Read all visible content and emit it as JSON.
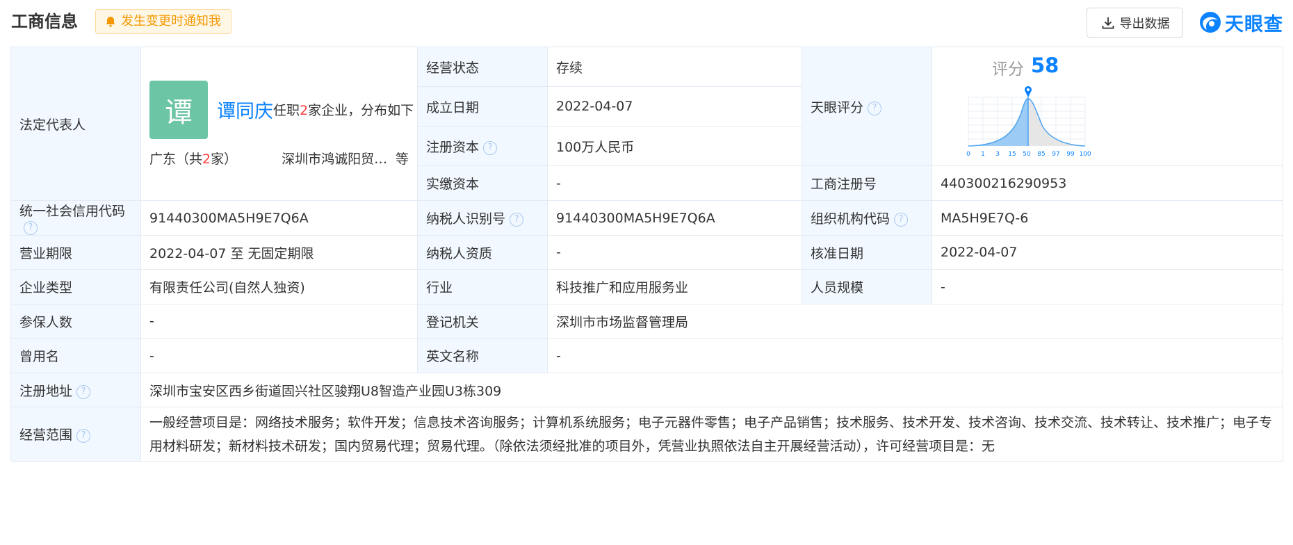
{
  "header": {
    "title": "工商信息",
    "notify_label": "发生变更时通知我",
    "export_label": "导出数据",
    "logo_text": "天眼查"
  },
  "colors": {
    "accent": "#0b83ff",
    "key_bg": "#f2f8ff",
    "border": "#e4eaf2",
    "notify_bg": "#fff7e6",
    "notify_text": "#f39800",
    "avatar_bg": "#6cc5a5",
    "highlight_red": "#ff3c3c"
  },
  "legal_rep": {
    "label": "法定代表人",
    "avatar_char": "谭",
    "name": "谭同庆",
    "desc_prefix": "任职",
    "desc_count": "2",
    "desc_suffix": "家企业，分布如下",
    "region_prefix": "广东（共",
    "region_count": "2",
    "region_suffix": "家）",
    "company": "深圳市鸿诚阳贸易有...",
    "more": "等"
  },
  "fields": {
    "status_label": "经营状态",
    "status_value": "存续",
    "founded_label": "成立日期",
    "founded_value": "2022-04-07",
    "reg_capital_label": "注册资本",
    "reg_capital_value": "100万人民币",
    "paid_capital_label": "实缴资本",
    "paid_capital_value": "-",
    "score_label": "天眼评分",
    "reg_no_label": "工商注册号",
    "reg_no_value": "440300216290953",
    "credit_code_label": "统一社会信用代码",
    "credit_code_value": "91440300MA5H9E7Q6A",
    "taxpayer_id_label": "纳税人识别号",
    "taxpayer_id_value": "91440300MA5H9E7Q6A",
    "org_code_label": "组织机构代码",
    "org_code_value": "MA5H9E7Q-6",
    "term_label": "营业期限",
    "term_value": "2022-04-07 至 无固定期限",
    "taxpayer_qual_label": "纳税人资质",
    "taxpayer_qual_value": "-",
    "approve_date_label": "核准日期",
    "approve_date_value": "2022-04-07",
    "type_label": "企业类型",
    "type_value": "有限责任公司(自然人独资)",
    "industry_label": "行业",
    "industry_value": "科技推广和应用服务业",
    "staff_size_label": "人员规模",
    "staff_size_value": "-",
    "insured_label": "参保人数",
    "insured_value": "-",
    "authority_label": "登记机关",
    "authority_value": "深圳市市场监督管理局",
    "former_name_label": "曾用名",
    "former_name_value": "-",
    "english_name_label": "英文名称",
    "english_name_value": "-",
    "address_label": "注册地址",
    "address_value": "深圳市宝安区西乡街道固兴社区骏翔U8智造产业园U3栋309",
    "scope_label": "经营范围",
    "scope_value": "一般经营项目是：网络技术服务；软件开发；信息技术咨询服务；计算机系统服务；电子元器件零售；电子产品销售；技术服务、技术开发、技术咨询、技术交流、技术转让、技术推广；电子专用材料研发；新材料技术研发；国内贸易代理；贸易代理。（除依法须经批准的项目外，凭营业执照依法自主开展经营活动），许可经营项目是：无"
  },
  "score": {
    "label": "评分",
    "value": "58",
    "axis_ticks": [
      "0",
      "1",
      "3",
      "15",
      "50",
      "85",
      "97",
      "99",
      "100"
    ]
  }
}
